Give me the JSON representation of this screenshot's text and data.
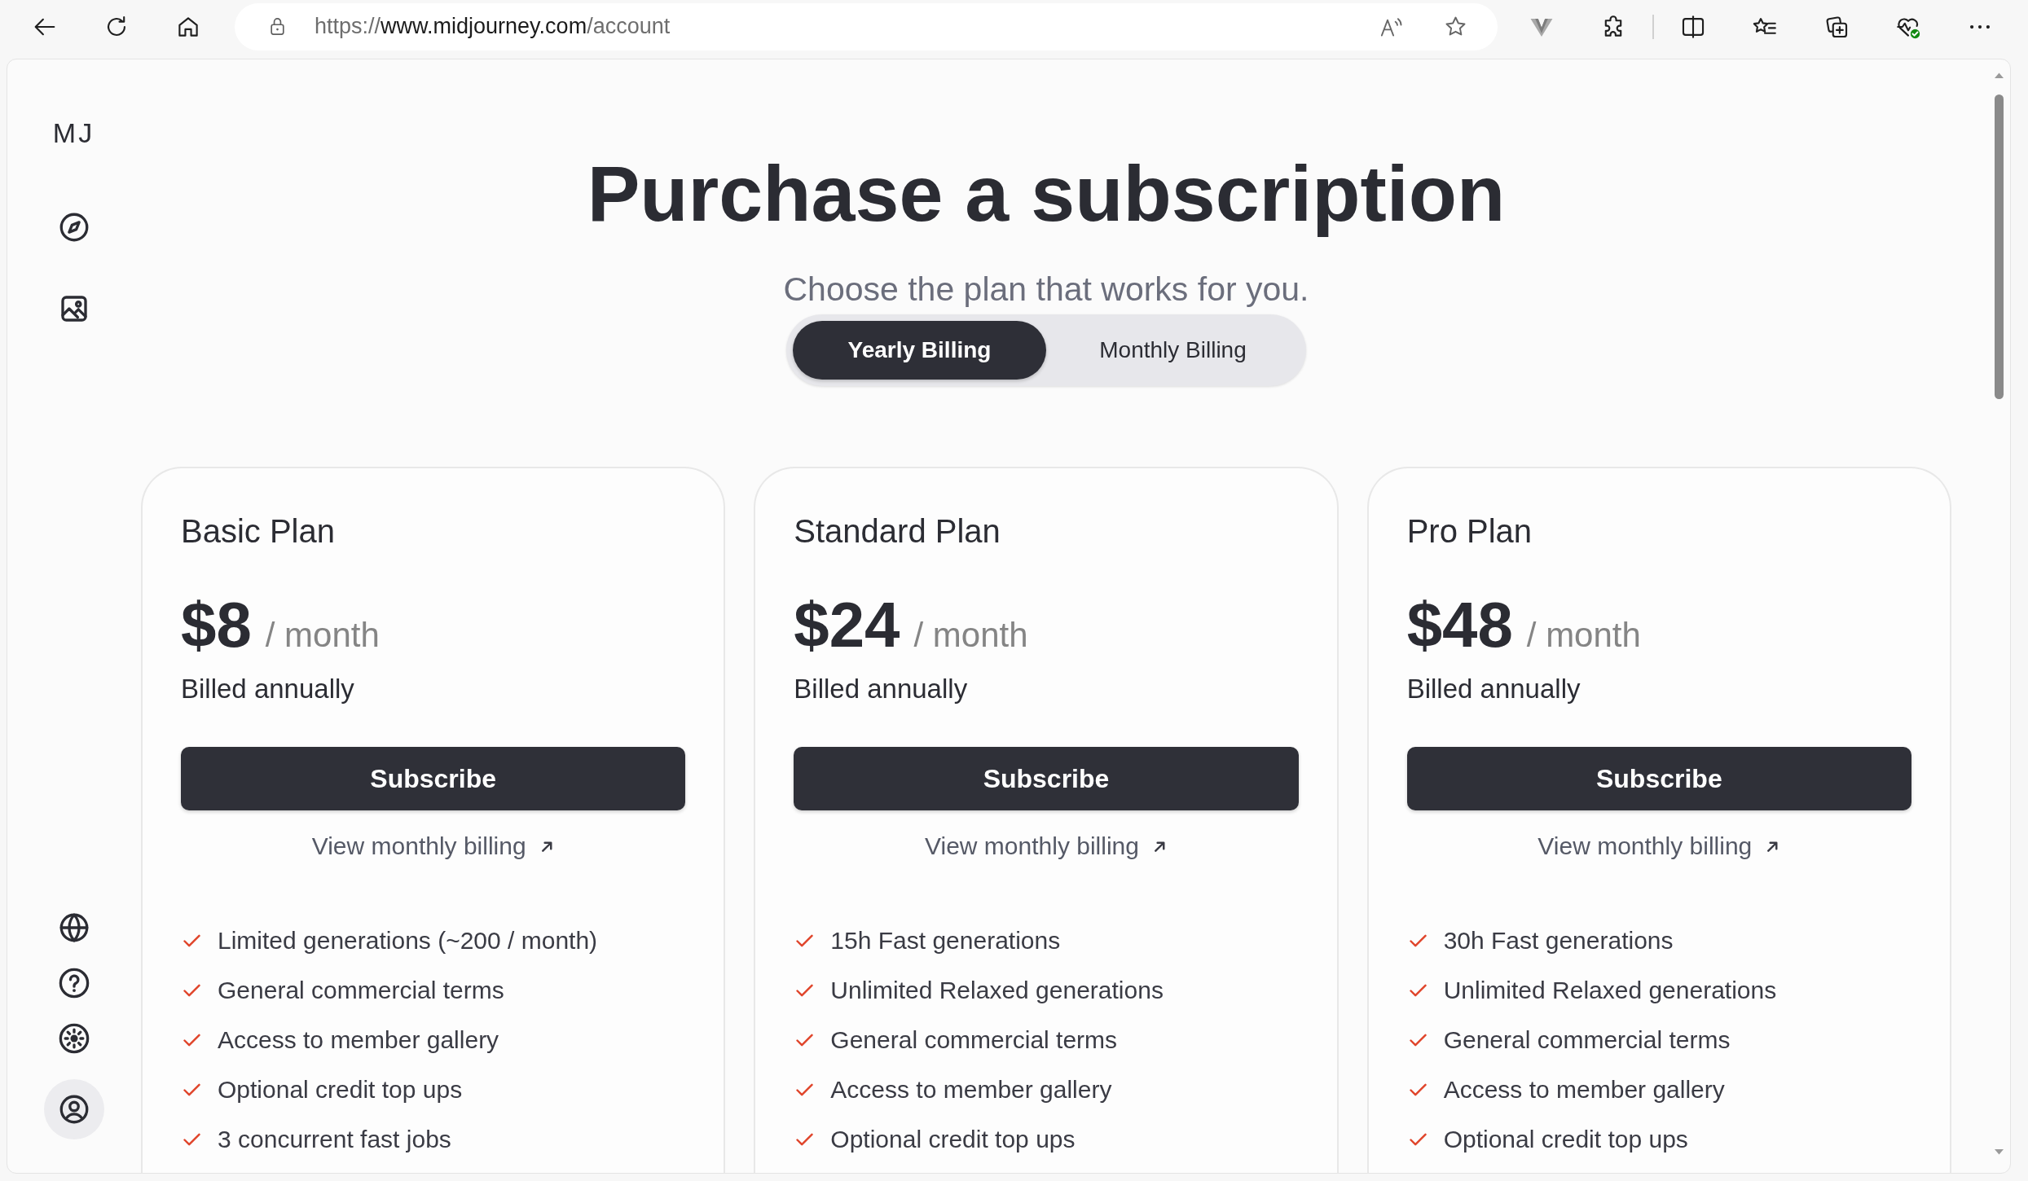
{
  "browser": {
    "url": {
      "scheme": "https://",
      "host": "www.midjourney.com",
      "path": "/account"
    }
  },
  "sidebar": {
    "logo": "MJ",
    "nav_items": [
      {
        "selected": false
      },
      {
        "selected": false
      }
    ],
    "footer_items": [
      {
        "selected": false
      },
      {
        "selected": false
      },
      {
        "selected": false
      },
      {
        "selected": true
      }
    ]
  },
  "header": {
    "title": "Purchase a subscription",
    "subtitle": "Choose the plan that works for you."
  },
  "billing_toggle": [
    {
      "label": "Yearly Billing",
      "selected": true
    },
    {
      "label": "Monthly Billing",
      "selected": false
    }
  ],
  "plans": [
    {
      "name": "Basic Plan",
      "price": "$8",
      "period": "/ month",
      "billing_note": "Billed annually",
      "button": "Subscribe",
      "link": "View monthly billing",
      "features": [
        "Limited generations (~200 / month)",
        "General commercial terms",
        "Access to member gallery",
        "Optional credit top ups",
        "3 concurrent fast jobs"
      ]
    },
    {
      "name": "Standard Plan",
      "price": "$24",
      "period": "/ month",
      "billing_note": "Billed annually",
      "button": "Subscribe",
      "link": "View monthly billing",
      "features": [
        "15h Fast generations",
        "Unlimited Relaxed generations",
        "General commercial terms",
        "Access to member gallery",
        "Optional credit top ups"
      ]
    },
    {
      "name": "Pro Plan",
      "price": "$48",
      "period": "/ month",
      "billing_note": "Billed annually",
      "button": "Subscribe",
      "link": "View monthly billing",
      "features": [
        "30h Fast generations",
        "Unlimited Relaxed generations",
        "General commercial terms",
        "Access to member gallery",
        "Optional credit top ups"
      ]
    }
  ]
}
